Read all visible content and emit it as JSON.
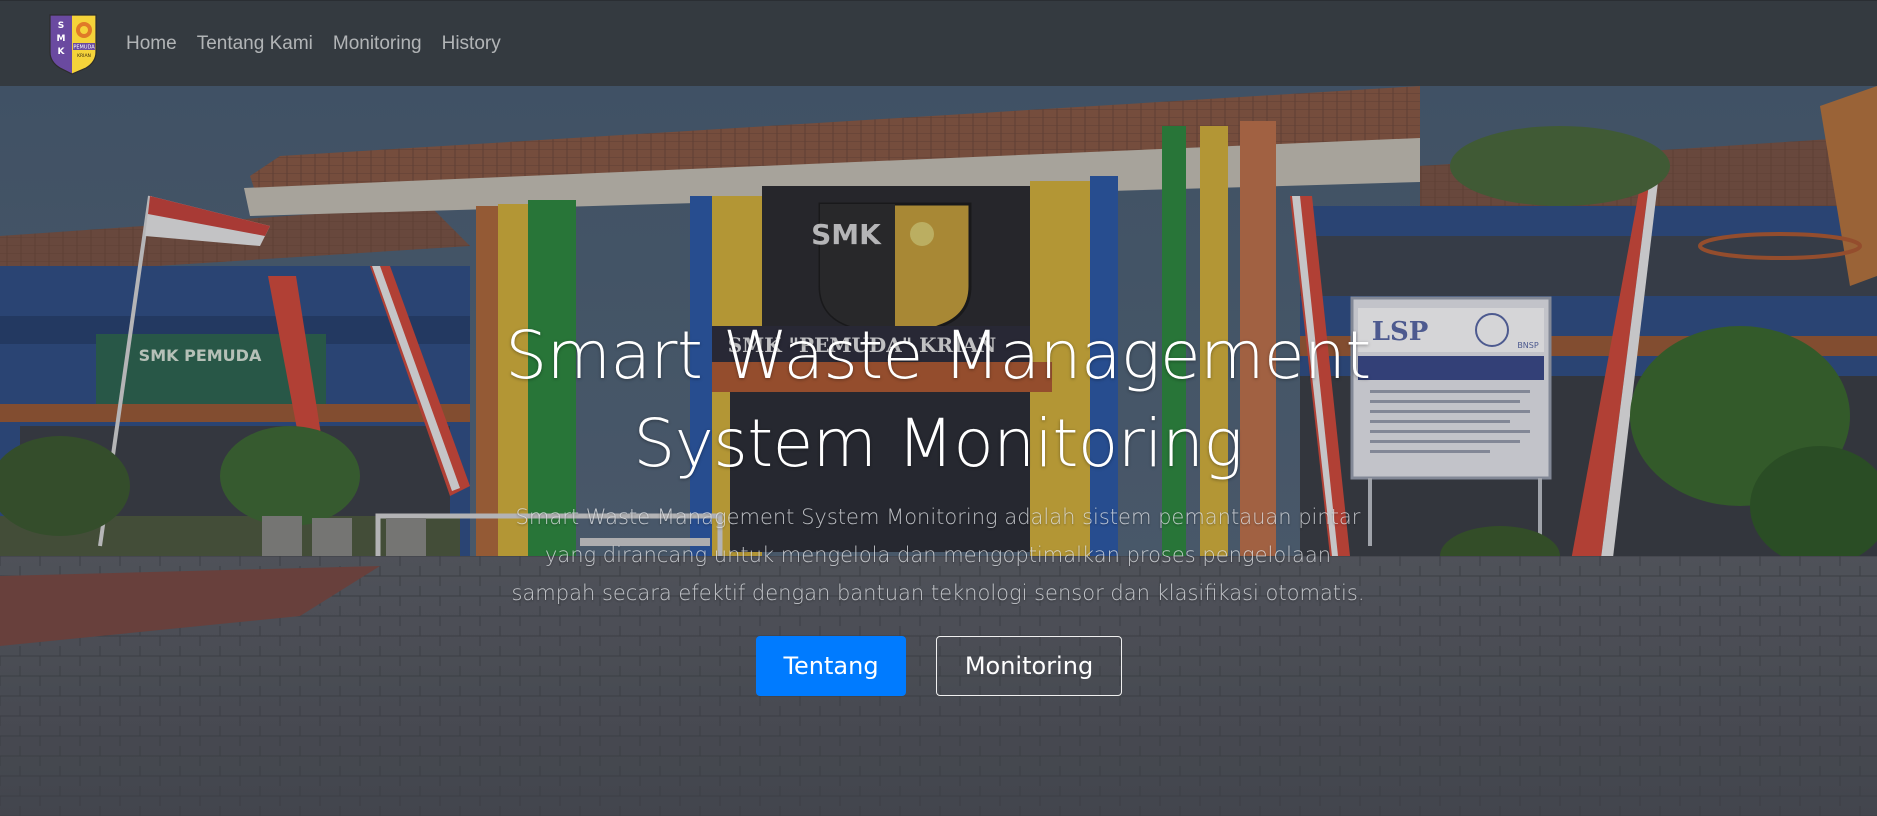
{
  "navbar": {
    "logo": {
      "line1": "S M K",
      "line2": "PEMUDA",
      "line3": "KRIAN"
    },
    "links": [
      "Home",
      "Tentang Kami",
      "Monitoring",
      "History"
    ]
  },
  "hero": {
    "title": "Smart Waste Management System Monitoring",
    "description": "Smart Waste Management System Monitoring adalah sistem pemantauan pintar yang dirancang untuk mengelola dan mengoptimalkan proses pengelolaan sampah secara efektif dengan bantuan teknologi sensor dan klasifikasi otomatis.",
    "primary_button": "Tentang",
    "secondary_button": "Monitoring",
    "photo": {
      "school_sign": "SMK \"PEMUDA\" KRIAN",
      "sign_left": "SMK PEMUDA",
      "board_title": "LSP",
      "board_subtitle": "LEMBAGA SERTIFIKASI PROFESI SMK \"PEMUDA\" KRIAN",
      "board_badge": "BNSP",
      "emblem_text": "SMK"
    }
  },
  "colors": {
    "navbar_bg": "#343a40",
    "primary": "#007bff",
    "nav_text": "rgba(255,255,255,0.62)"
  }
}
